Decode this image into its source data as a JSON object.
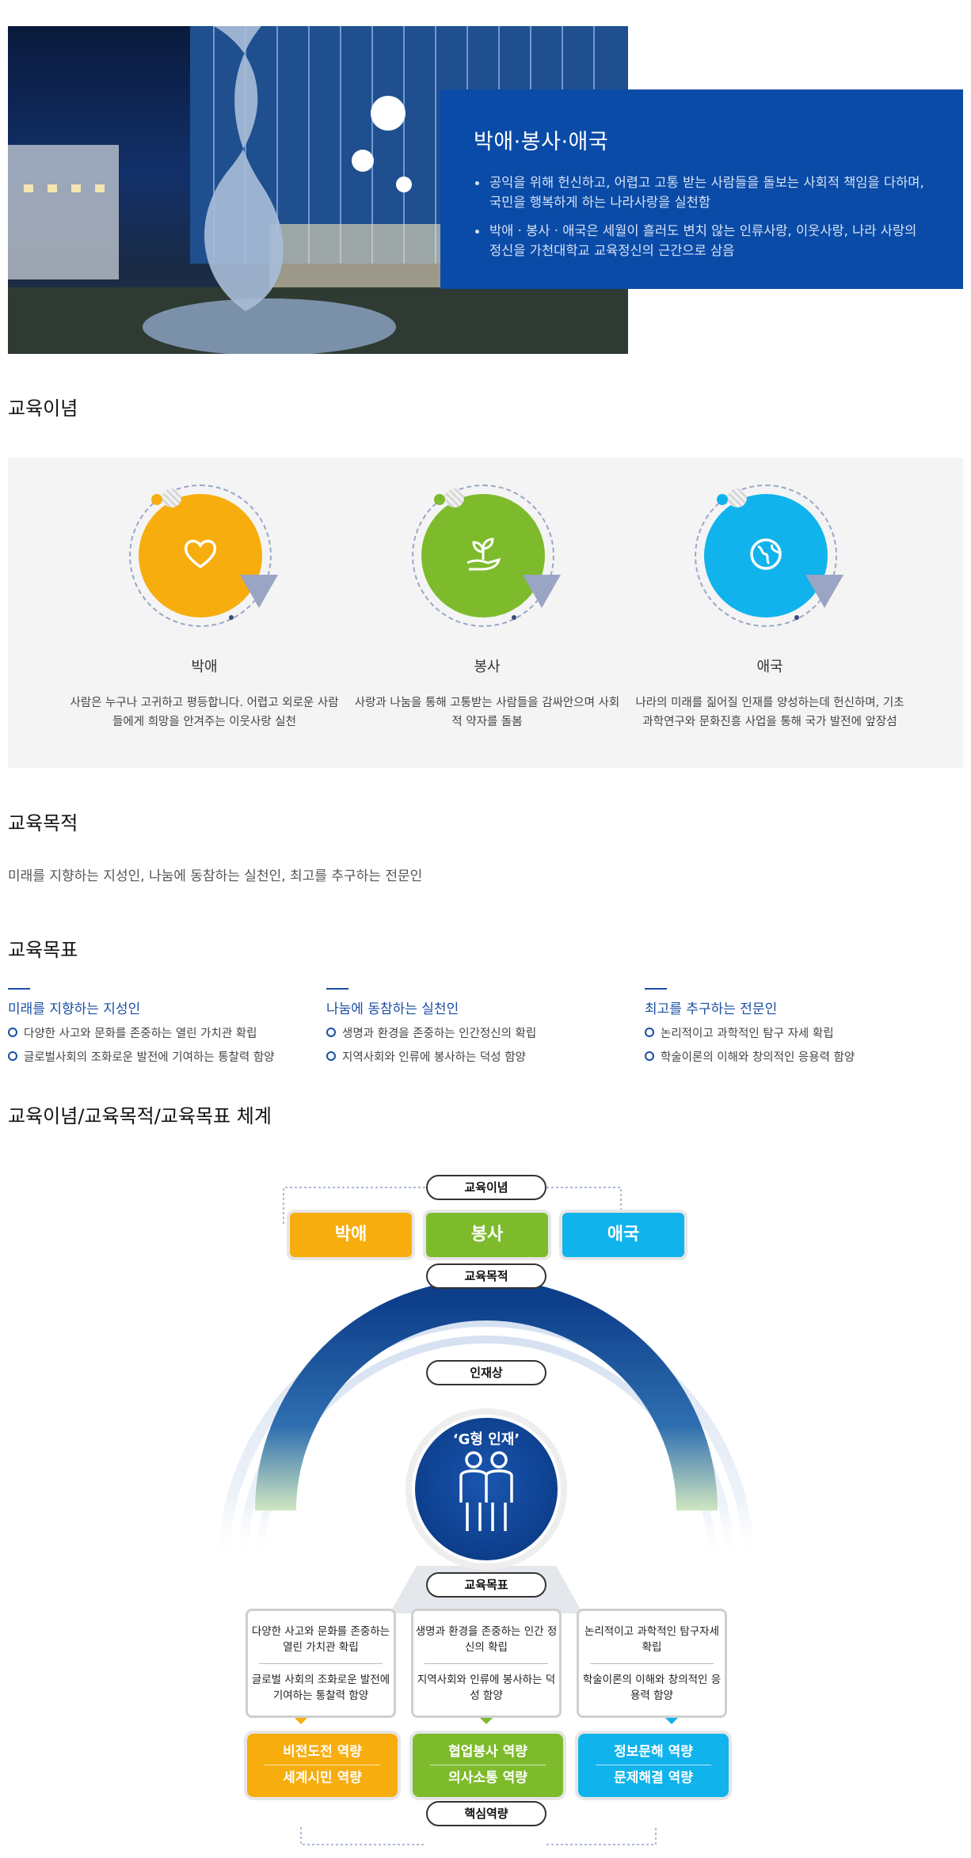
{
  "hero": {
    "title": "박애·봉사·애국",
    "bullets": [
      "공익을 위해 헌신하고, 어렵고 고통 받는 사람들을 돌보는 사회적 책임을 다하며, 국민을 행복하게 하는 나라사랑을 실천함",
      "박애 · 봉사 · 애국은 세월이 흘러도 변치 않는 인류사랑, 이웃사랑, 나라 사랑의 정신을 가천대학교 교육정신의 근간으로 삼음"
    ]
  },
  "philosophy": {
    "heading": "교육이념",
    "items": [
      {
        "name": "박애",
        "icon": "heart-icon",
        "color": "#f7ad0e",
        "desc": "사람은 누구나 고귀하고 평등합니다. 어렵고 외로운 사람들에게 희망을 안겨주는 이웃사랑 실천"
      },
      {
        "name": "봉사",
        "icon": "sprout-in-hand-icon",
        "color": "#7dbb2c",
        "desc": "사랑과 나눔을 통해 고통받는 사람들을 감싸안으며 사회적 약자를 돌봄"
      },
      {
        "name": "애국",
        "icon": "globe-icon",
        "color": "#11b3ec",
        "desc": "나라의 미래를 짊어질 인재를 양성하는데 헌신하며, 기초과학연구와 문화진흥 사업을 통해 국가 발전에 앞장섬"
      }
    ]
  },
  "purpose": {
    "heading": "교육목적",
    "text": "미래를 지향하는 지성인, 나눔에 동참하는 실천인, 최고를 추구하는 전문인"
  },
  "targets": {
    "heading": "교육목표",
    "columns": [
      {
        "title": "미래를 지향하는 지성인",
        "items": [
          "다양한 사고와 문화를 존중하는 열린 가치관 확립",
          "글로벌사회의 조화로운 발전에 기여하는 통찰력 함양"
        ]
      },
      {
        "title": "나눔에 동참하는 실천인",
        "items": [
          "생명과 환경을 존중하는 인간정신의 확립",
          "지역사회와 인류에 봉사하는 덕성 함양"
        ]
      },
      {
        "title": "최고를 추구하는 전문인",
        "items": [
          "논리적이고 과학적인 탐구 자세 확립",
          "학술이론의 이해와 창의적인 응용력 함양"
        ]
      }
    ]
  },
  "system": {
    "heading": "교육이념/교육목적/교육목표 체계",
    "labels": {
      "philosophy": "교육이념",
      "purpose": "교육목적",
      "talent": "인재상",
      "goals": "교육목표",
      "competency": "핵심역량"
    },
    "values": [
      {
        "label": "박애",
        "color": "#f7ad0e"
      },
      {
        "label": "봉사",
        "color": "#7dbb2c"
      },
      {
        "label": "애국",
        "color": "#11b3ec"
      }
    ],
    "arc_text": "미래를 지향하는 지성인 • 나눔에 동참하는 실천인 • 최고를 추구하는 전문인",
    "center_label": "‘G형 인재’",
    "goal_boxes": [
      {
        "a": "다양한 사고와 문화를 존중하는 열린 가치관 확립",
        "b": "글로벌 사회의 조화로운 발전에 기여하는 통찰력 함양"
      },
      {
        "a": "생명과 환경을 존중하는 인간 정신의 확립",
        "b": "지역사회와 인류에 봉사하는 덕성 함양"
      },
      {
        "a": "논리적이고 과학적인 탐구자세 확립",
        "b": "학술이론의 이해와 창의적인 응용력 함양"
      }
    ],
    "competencies": [
      {
        "a": "비전도전 역량",
        "b": "세계시민 역량",
        "color": "#f7ad0e"
      },
      {
        "a": "협업봉사 역량",
        "b": "의사소통 역량",
        "color": "#7dbb2c"
      },
      {
        "a": "정보문해 역량",
        "b": "문제해결 역량",
        "color": "#11b3ec"
      }
    ]
  }
}
